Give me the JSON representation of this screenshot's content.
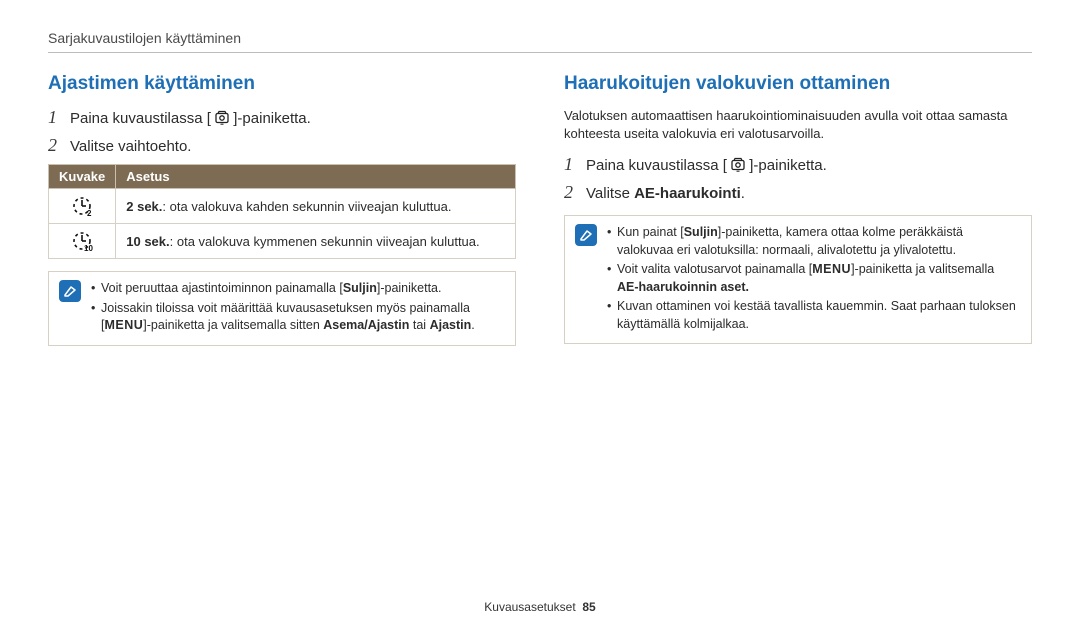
{
  "breadcrumb": "Sarjakuvaustilojen käyttäminen",
  "left": {
    "heading": "Ajastimen käyttäminen",
    "step1_pre": "Paina kuvaustilassa [",
    "step1_post": "]-painiketta.",
    "step2": "Valitse vaihtoehto.",
    "table": {
      "h1": "Kuvake",
      "h2": "Asetus",
      "r1_sub": "2",
      "r1_b": "2 sek.",
      "r1_t": ": ota valokuva kahden sekunnin viiveajan kuluttua.",
      "r2_sub": "10",
      "r2_b": "10 sek.",
      "r2_t": ": ota valokuva kymmenen sekunnin viiveajan kuluttua."
    },
    "note": {
      "l1a": "Voit peruuttaa ajastintoiminnon painamalla [",
      "l1b": "Suljin",
      "l1c": "]-painiketta.",
      "l2a": "Joissakin tiloissa voit määrittää kuvausasetuksen myös painamalla [",
      "l2b": "MENU",
      "l2c": "]-painiketta ja valitsemalla sitten ",
      "l2d": "Asema/Ajastin",
      "l2e": " tai ",
      "l2f": "Ajastin",
      "l2g": "."
    }
  },
  "right": {
    "heading": "Haarukoitujen valokuvien ottaminen",
    "intro": "Valotuksen automaattisen haarukointiominaisuuden avulla voit ottaa samasta kohteesta useita valokuvia eri valotusarvoilla.",
    "step1_pre": "Paina kuvaustilassa [",
    "step1_post": "]-painiketta.",
    "step2a": "Valitse ",
    "step2b": "AE-haarukointi",
    "step2c": ".",
    "note": {
      "l1a": "Kun painat [",
      "l1b": "Suljin",
      "l1c": "]-painiketta, kamera ottaa kolme peräkkäistä valokuvaa eri valotuksilla: normaali, alivalotettu ja ylivalotettu.",
      "l2a": "Voit valita valotusarvot painamalla [",
      "l2b": "MENU",
      "l2c": "]-painiketta ja valitsemalla ",
      "l2d": "AE-haarukoinnin aset.",
      "l3": "Kuvan ottaminen voi kestää tavallista kauemmin. Saat parhaan tuloksen käyttämällä kolmijalkaa."
    }
  },
  "footer_label": "Kuvausasetukset",
  "footer_page": "85"
}
